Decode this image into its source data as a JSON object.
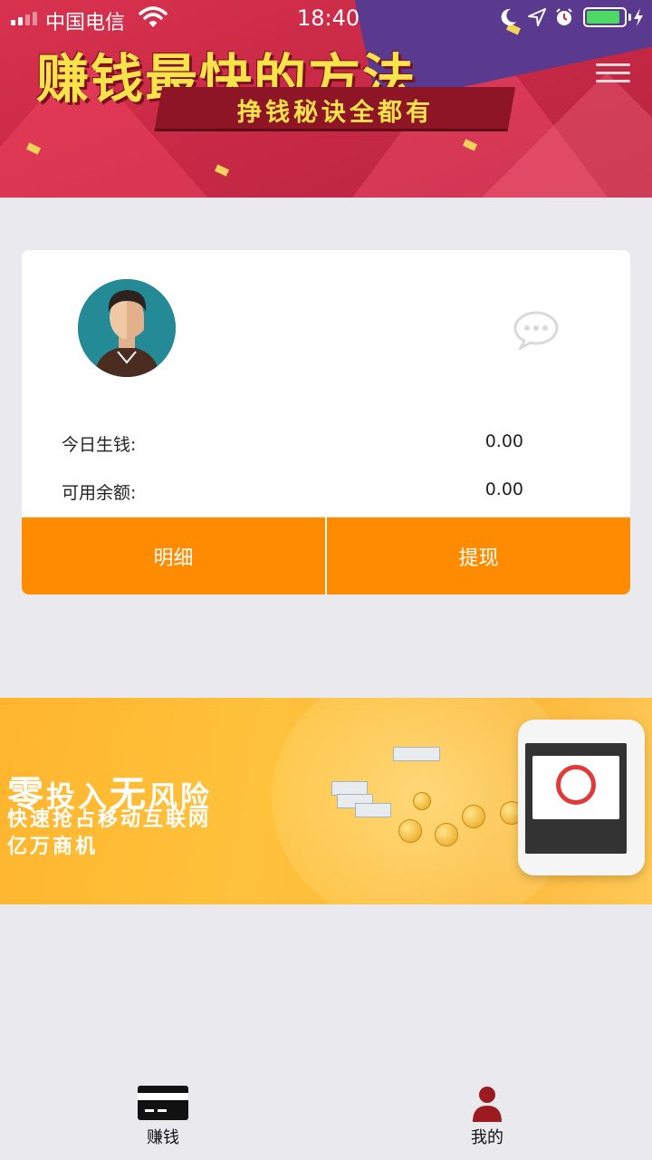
{
  "status_bar": {
    "carrier": "中国电信",
    "time": "18:40",
    "battery_level": 0.9
  },
  "banner": {
    "title": "赚钱最快的方法",
    "subtitle": "挣钱秘诀全都有"
  },
  "account": {
    "stats": [
      {
        "label": "今日生钱:",
        "value": "0.00"
      },
      {
        "label": "可用余额:",
        "value": "0.00"
      }
    ],
    "actions": {
      "detail_label": "明细",
      "withdraw_label": "提现"
    }
  },
  "promo": {
    "line1_a": "零",
    "line1_b": "投入",
    "line1_c": "无",
    "line1_d": "风险",
    "line2": "快速抢占移动互联网",
    "line3": "亿万商机"
  },
  "tabs": [
    {
      "label": "赚钱",
      "icon": "card-icon"
    },
    {
      "label": "我的",
      "icon": "person-icon"
    }
  ],
  "colors": {
    "accent": "#ff8c00",
    "background": "#eae9ee",
    "tab_mine": "#9b1b22"
  }
}
